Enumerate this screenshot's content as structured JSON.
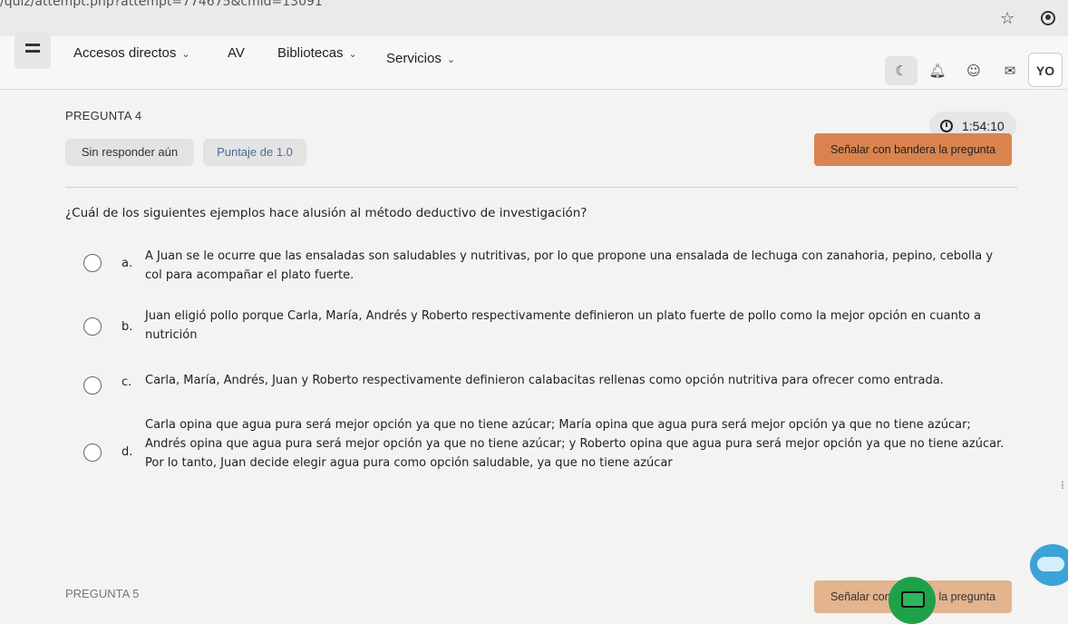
{
  "browser": {
    "url_fragment": "/quiz/attempt.php?attempt=774675&cmid=13091"
  },
  "navbar": {
    "items": [
      {
        "label": "Accesos directos",
        "dropdown": true
      },
      {
        "label": "AV",
        "dropdown": false
      },
      {
        "label": "Bibliotecas",
        "dropdown": true
      },
      {
        "label": "Servicios",
        "dropdown": true
      }
    ],
    "icons": [
      "moon-icon",
      "bell-icon",
      "chat-bubble-icon",
      "mail-icon"
    ],
    "user_initials": "YO"
  },
  "question": {
    "number_label": "PREGUNTA 4",
    "timer": "1:54:10",
    "status": "Sin responder aún",
    "points": "Puntaje de 1.0",
    "flag_label": "Señalar con bandera la pregunta",
    "text": "¿Cuál de los siguientes ejemplos hace alusión al método deductivo de investigación?",
    "options": [
      {
        "letter": "a.",
        "text": "A Juan se le ocurre que las ensaladas son saludables y nutritivas, por lo que propone una ensalada de lechuga con zanahoria, pepino, cebolla y col para acompañar el plato fuerte.",
        "selected": false
      },
      {
        "letter": "b.",
        "text": "Juan eligió pollo porque Carla, María, Andrés y Roberto respectivamente definieron un plato fuerte de pollo como la mejor opción en cuanto a nutrición",
        "selected": false
      },
      {
        "letter": "c.",
        "text": "Carla, María, Andrés, Juan y Roberto respectivamente definieron calabacitas rellenas como opción nutritiva para ofrecer como entrada.",
        "selected": false
      },
      {
        "letter": "d.",
        "text": "Carla opina que agua pura será mejor opción ya que no tiene azúcar; María opina que agua pura será mejor opción ya que no tiene azúcar; Andrés opina que agua pura será mejor opción ya que no tiene azúcar; y Roberto opina que agua pura será mejor opción ya que no tiene azúcar. Por lo tanto, Juan decide elegir agua pura como opción saludable, ya que no tiene azúcar",
        "selected": false
      }
    ]
  },
  "next_question": {
    "number_label": "PREGUNTA 5",
    "flag_label": "Señalar con bandera la pregunta"
  },
  "colors": {
    "flag_button": "#d9844f",
    "points_text": "#4a6d92",
    "chat_widget": "#1fa04a",
    "helper_bot": "#3ba3d8"
  }
}
